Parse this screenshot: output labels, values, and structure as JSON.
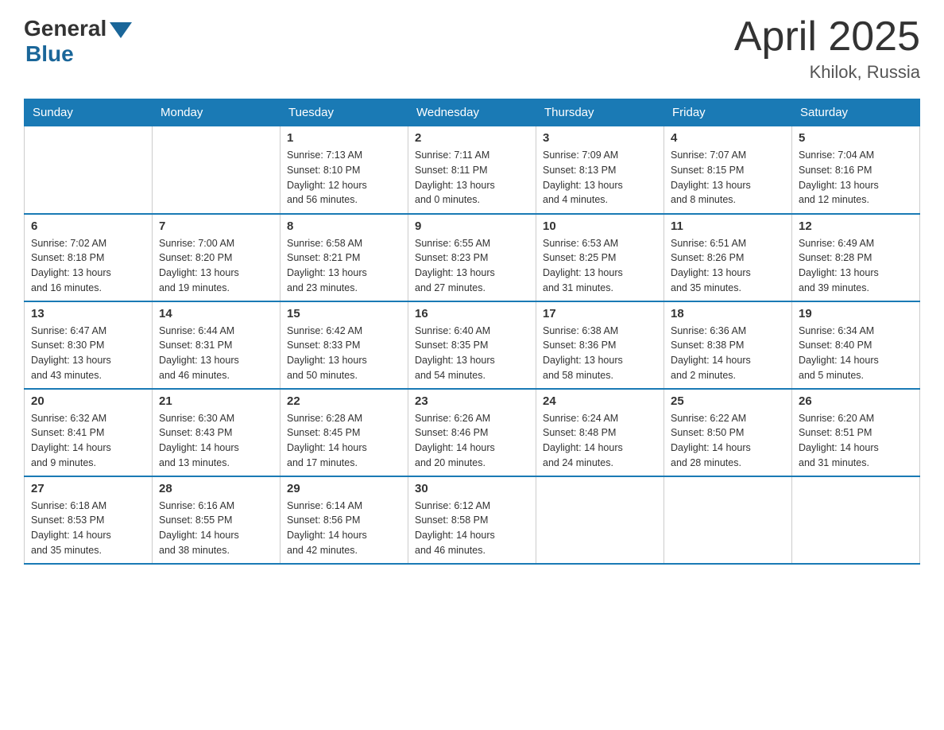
{
  "header": {
    "logo_general": "General",
    "logo_blue": "Blue",
    "title": "April 2025",
    "subtitle": "Khilok, Russia"
  },
  "weekdays": [
    "Sunday",
    "Monday",
    "Tuesday",
    "Wednesday",
    "Thursday",
    "Friday",
    "Saturday"
  ],
  "weeks": [
    [
      {
        "day": "",
        "info": ""
      },
      {
        "day": "",
        "info": ""
      },
      {
        "day": "1",
        "info": "Sunrise: 7:13 AM\nSunset: 8:10 PM\nDaylight: 12 hours\nand 56 minutes."
      },
      {
        "day": "2",
        "info": "Sunrise: 7:11 AM\nSunset: 8:11 PM\nDaylight: 13 hours\nand 0 minutes."
      },
      {
        "day": "3",
        "info": "Sunrise: 7:09 AM\nSunset: 8:13 PM\nDaylight: 13 hours\nand 4 minutes."
      },
      {
        "day": "4",
        "info": "Sunrise: 7:07 AM\nSunset: 8:15 PM\nDaylight: 13 hours\nand 8 minutes."
      },
      {
        "day": "5",
        "info": "Sunrise: 7:04 AM\nSunset: 8:16 PM\nDaylight: 13 hours\nand 12 minutes."
      }
    ],
    [
      {
        "day": "6",
        "info": "Sunrise: 7:02 AM\nSunset: 8:18 PM\nDaylight: 13 hours\nand 16 minutes."
      },
      {
        "day": "7",
        "info": "Sunrise: 7:00 AM\nSunset: 8:20 PM\nDaylight: 13 hours\nand 19 minutes."
      },
      {
        "day": "8",
        "info": "Sunrise: 6:58 AM\nSunset: 8:21 PM\nDaylight: 13 hours\nand 23 minutes."
      },
      {
        "day": "9",
        "info": "Sunrise: 6:55 AM\nSunset: 8:23 PM\nDaylight: 13 hours\nand 27 minutes."
      },
      {
        "day": "10",
        "info": "Sunrise: 6:53 AM\nSunset: 8:25 PM\nDaylight: 13 hours\nand 31 minutes."
      },
      {
        "day": "11",
        "info": "Sunrise: 6:51 AM\nSunset: 8:26 PM\nDaylight: 13 hours\nand 35 minutes."
      },
      {
        "day": "12",
        "info": "Sunrise: 6:49 AM\nSunset: 8:28 PM\nDaylight: 13 hours\nand 39 minutes."
      }
    ],
    [
      {
        "day": "13",
        "info": "Sunrise: 6:47 AM\nSunset: 8:30 PM\nDaylight: 13 hours\nand 43 minutes."
      },
      {
        "day": "14",
        "info": "Sunrise: 6:44 AM\nSunset: 8:31 PM\nDaylight: 13 hours\nand 46 minutes."
      },
      {
        "day": "15",
        "info": "Sunrise: 6:42 AM\nSunset: 8:33 PM\nDaylight: 13 hours\nand 50 minutes."
      },
      {
        "day": "16",
        "info": "Sunrise: 6:40 AM\nSunset: 8:35 PM\nDaylight: 13 hours\nand 54 minutes."
      },
      {
        "day": "17",
        "info": "Sunrise: 6:38 AM\nSunset: 8:36 PM\nDaylight: 13 hours\nand 58 minutes."
      },
      {
        "day": "18",
        "info": "Sunrise: 6:36 AM\nSunset: 8:38 PM\nDaylight: 14 hours\nand 2 minutes."
      },
      {
        "day": "19",
        "info": "Sunrise: 6:34 AM\nSunset: 8:40 PM\nDaylight: 14 hours\nand 5 minutes."
      }
    ],
    [
      {
        "day": "20",
        "info": "Sunrise: 6:32 AM\nSunset: 8:41 PM\nDaylight: 14 hours\nand 9 minutes."
      },
      {
        "day": "21",
        "info": "Sunrise: 6:30 AM\nSunset: 8:43 PM\nDaylight: 14 hours\nand 13 minutes."
      },
      {
        "day": "22",
        "info": "Sunrise: 6:28 AM\nSunset: 8:45 PM\nDaylight: 14 hours\nand 17 minutes."
      },
      {
        "day": "23",
        "info": "Sunrise: 6:26 AM\nSunset: 8:46 PM\nDaylight: 14 hours\nand 20 minutes."
      },
      {
        "day": "24",
        "info": "Sunrise: 6:24 AM\nSunset: 8:48 PM\nDaylight: 14 hours\nand 24 minutes."
      },
      {
        "day": "25",
        "info": "Sunrise: 6:22 AM\nSunset: 8:50 PM\nDaylight: 14 hours\nand 28 minutes."
      },
      {
        "day": "26",
        "info": "Sunrise: 6:20 AM\nSunset: 8:51 PM\nDaylight: 14 hours\nand 31 minutes."
      }
    ],
    [
      {
        "day": "27",
        "info": "Sunrise: 6:18 AM\nSunset: 8:53 PM\nDaylight: 14 hours\nand 35 minutes."
      },
      {
        "day": "28",
        "info": "Sunrise: 6:16 AM\nSunset: 8:55 PM\nDaylight: 14 hours\nand 38 minutes."
      },
      {
        "day": "29",
        "info": "Sunrise: 6:14 AM\nSunset: 8:56 PM\nDaylight: 14 hours\nand 42 minutes."
      },
      {
        "day": "30",
        "info": "Sunrise: 6:12 AM\nSunset: 8:58 PM\nDaylight: 14 hours\nand 46 minutes."
      },
      {
        "day": "",
        "info": ""
      },
      {
        "day": "",
        "info": ""
      },
      {
        "day": "",
        "info": ""
      }
    ]
  ]
}
